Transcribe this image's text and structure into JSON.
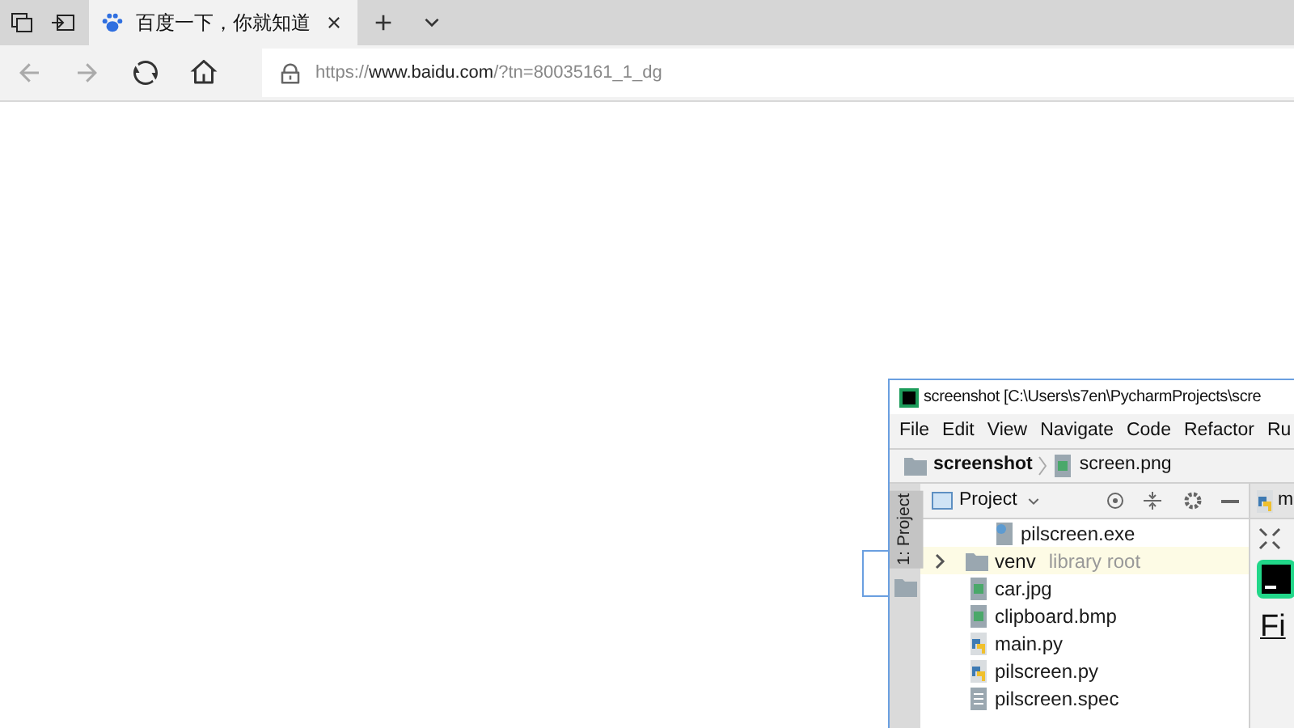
{
  "browser": {
    "tab": {
      "title": "百度一下，你就知道",
      "selected": true
    },
    "address": {
      "scheme": "https://",
      "host": "www.baidu.com",
      "path": "/?tn=80035161_1_dg"
    }
  },
  "ide": {
    "window": {
      "title": "screenshot [C:\\Users\\s7en\\PycharmProjects\\scre"
    },
    "menu": [
      "File",
      "Edit",
      "View",
      "Navigate",
      "Code",
      "Refactor",
      "Ru"
    ],
    "breadcrumb": [
      "screenshot",
      "screen.png"
    ],
    "side_tab": "1: Project",
    "project": {
      "title": "Project",
      "items": [
        {
          "children": [
            {
              "name": "pilscreen.exe",
              "kind": "exe",
              "selected": false
            }
          ]
        },
        {
          "name": "venv",
          "note": "library root",
          "kind": "folder",
          "expanded": false,
          "selected": false
        },
        {
          "name": "car.jpg",
          "kind": "image",
          "selected": false
        },
        {
          "name": "clipboard.bmp",
          "kind": "image",
          "selected": false
        },
        {
          "name": "main.py",
          "kind": "python",
          "selected": false
        },
        {
          "name": "pilscreen.py",
          "kind": "python",
          "selected": false
        },
        {
          "name": "pilscreen.spec",
          "kind": "spec",
          "selected": false
        }
      ]
    },
    "editor_tab": "m",
    "welcome": "Fi"
  }
}
